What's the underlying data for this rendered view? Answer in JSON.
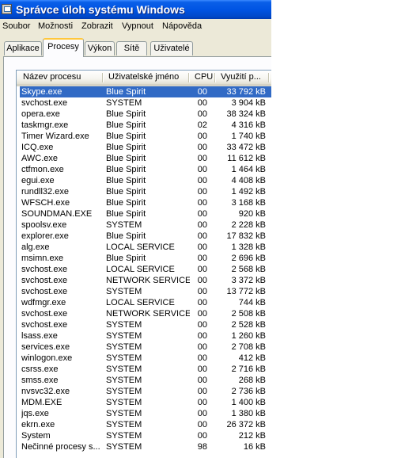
{
  "window": {
    "title": "Správce úloh systému Windows"
  },
  "menu": [
    "Soubor",
    "Možnosti",
    "Zobrazit",
    "Vypnout",
    "Nápověda"
  ],
  "tabs": [
    {
      "label": "Aplikace",
      "active": false
    },
    {
      "label": "Procesy",
      "active": true
    },
    {
      "label": "Výkon",
      "active": false
    },
    {
      "label": "Sítě",
      "active": false
    },
    {
      "label": "Uživatelé",
      "active": false
    }
  ],
  "columns": [
    "Název procesu",
    "Uživatelské jméno",
    "CPU",
    "Využití p..."
  ],
  "selected_row": 0,
  "processes": [
    {
      "name": "Skype.exe",
      "user": "Blue Spirit",
      "cpu": "00",
      "mem": "33 792 kB"
    },
    {
      "name": "svchost.exe",
      "user": "SYSTEM",
      "cpu": "00",
      "mem": "3 904 kB"
    },
    {
      "name": "opera.exe",
      "user": "Blue Spirit",
      "cpu": "00",
      "mem": "38 324 kB"
    },
    {
      "name": "taskmgr.exe",
      "user": "Blue Spirit",
      "cpu": "02",
      "mem": "4 316 kB"
    },
    {
      "name": "Timer Wizard.exe",
      "user": "Blue Spirit",
      "cpu": "00",
      "mem": "1 740 kB"
    },
    {
      "name": "ICQ.exe",
      "user": "Blue Spirit",
      "cpu": "00",
      "mem": "33 472 kB"
    },
    {
      "name": "AWC.exe",
      "user": "Blue Spirit",
      "cpu": "00",
      "mem": "11 612 kB"
    },
    {
      "name": "ctfmon.exe",
      "user": "Blue Spirit",
      "cpu": "00",
      "mem": "1 464 kB"
    },
    {
      "name": "egui.exe",
      "user": "Blue Spirit",
      "cpu": "00",
      "mem": "4 408 kB"
    },
    {
      "name": "rundll32.exe",
      "user": "Blue Spirit",
      "cpu": "00",
      "mem": "1 492 kB"
    },
    {
      "name": "WFSCH.exe",
      "user": "Blue Spirit",
      "cpu": "00",
      "mem": "3 168 kB"
    },
    {
      "name": "SOUNDMAN.EXE",
      "user": "Blue Spirit",
      "cpu": "00",
      "mem": "920 kB"
    },
    {
      "name": "spoolsv.exe",
      "user": "SYSTEM",
      "cpu": "00",
      "mem": "2 228 kB"
    },
    {
      "name": "explorer.exe",
      "user": "Blue Spirit",
      "cpu": "00",
      "mem": "17 832 kB"
    },
    {
      "name": "alg.exe",
      "user": "LOCAL SERVICE",
      "cpu": "00",
      "mem": "1 328 kB"
    },
    {
      "name": "msimn.exe",
      "user": "Blue Spirit",
      "cpu": "00",
      "mem": "2 696 kB"
    },
    {
      "name": "svchost.exe",
      "user": "LOCAL SERVICE",
      "cpu": "00",
      "mem": "2 568 kB"
    },
    {
      "name": "svchost.exe",
      "user": "NETWORK SERVICE",
      "cpu": "00",
      "mem": "3 372 kB"
    },
    {
      "name": "svchost.exe",
      "user": "SYSTEM",
      "cpu": "00",
      "mem": "13 772 kB"
    },
    {
      "name": "wdfmgr.exe",
      "user": "LOCAL SERVICE",
      "cpu": "00",
      "mem": "744 kB"
    },
    {
      "name": "svchost.exe",
      "user": "NETWORK SERVICE",
      "cpu": "00",
      "mem": "2 508 kB"
    },
    {
      "name": "svchost.exe",
      "user": "SYSTEM",
      "cpu": "00",
      "mem": "2 528 kB"
    },
    {
      "name": "lsass.exe",
      "user": "SYSTEM",
      "cpu": "00",
      "mem": "1 260 kB"
    },
    {
      "name": "services.exe",
      "user": "SYSTEM",
      "cpu": "00",
      "mem": "2 708 kB"
    },
    {
      "name": "winlogon.exe",
      "user": "SYSTEM",
      "cpu": "00",
      "mem": "412 kB"
    },
    {
      "name": "csrss.exe",
      "user": "SYSTEM",
      "cpu": "00",
      "mem": "2 716 kB"
    },
    {
      "name": "smss.exe",
      "user": "SYSTEM",
      "cpu": "00",
      "mem": "268 kB"
    },
    {
      "name": "nvsvc32.exe",
      "user": "SYSTEM",
      "cpu": "00",
      "mem": "2 736 kB"
    },
    {
      "name": "MDM.EXE",
      "user": "SYSTEM",
      "cpu": "00",
      "mem": "1 400 kB"
    },
    {
      "name": "jqs.exe",
      "user": "SYSTEM",
      "cpu": "00",
      "mem": "1 380 kB"
    },
    {
      "name": "ekrn.exe",
      "user": "SYSTEM",
      "cpu": "00",
      "mem": "26 372 kB"
    },
    {
      "name": "System",
      "user": "SYSTEM",
      "cpu": "00",
      "mem": "212 kB"
    },
    {
      "name": "Nečinné procesy s...",
      "user": "SYSTEM",
      "cpu": "98",
      "mem": "16 kB"
    }
  ]
}
